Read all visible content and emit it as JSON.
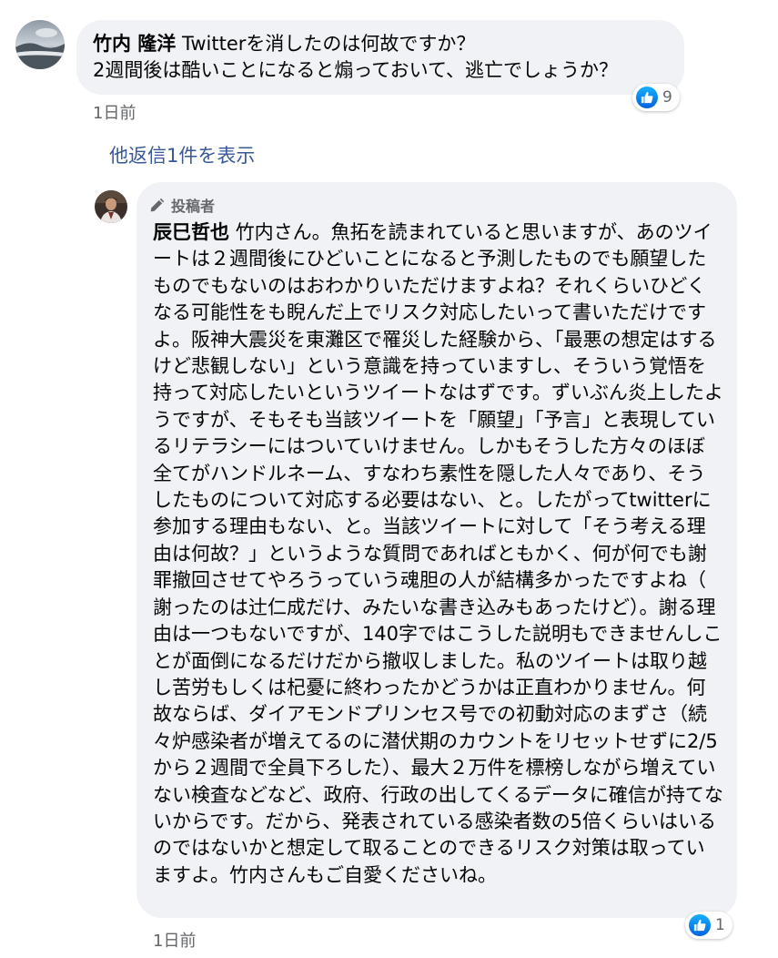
{
  "comment": {
    "author": "竹内 隆洋",
    "text_line1": "Twitterを消したのは何故ですか？",
    "text_line2": "2週間後は酷いことになると煽っておいて、逃亡でしょうか？",
    "reaction_count": "9",
    "timestamp": "1日前",
    "avatar_icon": "landscape-avatar-icon"
  },
  "more_replies_label": "他返信1件を表示",
  "reply": {
    "badge": "投稿者",
    "author": "辰巳哲也",
    "text": "竹内さん。魚拓を読まれていると思いますが、あのツイートは２週間後にひどいことになると予測したものでも願望したものでもないのはおわかりいただけますよね？それくらいひどくなる可能性をも睨んだ上でリスク対応したいって書いただけですよ。阪神大震災を東灘区で罹災した経験から、「最悪の想定はするけど悲観しない」という意識を持っていますし、そういう覚悟を持って対応したいというツイートなはずです。ずいぶん炎上したようですが、そもそも当該ツイートを「願望」「予言」と表現しているリテラシーにはついていけません。しかもそうした方々のほぼ全てがハンドルネーム、すなわち素性を隠した人々であり、そうしたものについて対応する必要はない、と。したがってtwitterに参加する理由もない、と。当該ツイートに対して「そう考える理由は何故？」というような質問であればともかく、何が何でも謝罪撤回させてやろうっていう魂胆の人が結構多かったですよね（謝ったのは辻仁成だけ、みたいな書き込みもあったけど）。謝る理由は一つもないですが、140字ではこうした説明もできませんしことが面倒になるだけだから撤収しました。私のツイートは取り越し苦労もしくは杞憂に終わったかどうかは正直わかりません。何故ならば、ダイアモンドプリンセス号での初動対応のまずさ（続々炉感染者が増えてるのに潜伏期のカウントをリセットせずに2/5から２週間で全員下ろした）、最大２万件を標榜しながら増えていない検査などなど、政府、行政の出してくるデータに確信が持てないからです。だから、発表されている感染者数の5倍くらいはいるのではないかと想定して取ることのできるリスク対策は取っていますよ。竹内さんもご自愛くださいね。",
    "reaction_count": "1",
    "timestamp": "1日前",
    "avatar_icon": "person-avatar-icon"
  },
  "colors": {
    "bubble_bg": "#f0f2f5",
    "link": "#385898",
    "meta_text": "#65676b",
    "like_blue": "#1877f2"
  }
}
